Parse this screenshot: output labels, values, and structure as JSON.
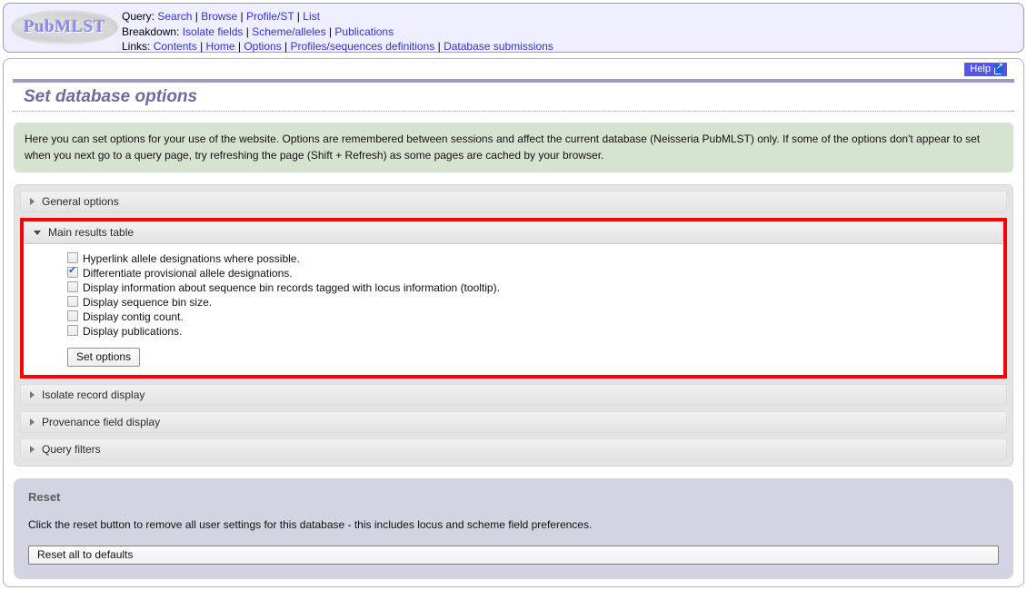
{
  "header": {
    "logo_text": "PubMLST",
    "rows": [
      {
        "label": "Query:",
        "links": [
          "Search",
          "Browse",
          "Profile/ST",
          "List"
        ]
      },
      {
        "label": "Breakdown:",
        "links": [
          "Isolate fields",
          "Scheme/alleles",
          "Publications"
        ]
      },
      {
        "label": "Links:",
        "links": [
          "Contents",
          "Home",
          "Options",
          "Profiles/sequences definitions",
          "Database submissions"
        ]
      }
    ]
  },
  "page": {
    "help_label": "Help",
    "title": "Set database options",
    "info_text": "Here you can set options for your use of the website. Options are remembered between sessions and affect the current database (Neisseria PubMLST) only. If some of the options don't appear to set when you next go to a query page, try refreshing the page (Shift + Refresh) as some pages are cached by your browser."
  },
  "accordion": {
    "general_options": {
      "label": "General options",
      "expanded": false
    },
    "main_results_table": {
      "label": "Main results table",
      "expanded": true,
      "highlighted": true,
      "options": [
        {
          "label": "Hyperlink allele designations where possible.",
          "checked": false
        },
        {
          "label": "Differentiate provisional allele designations.",
          "checked": true
        },
        {
          "label": "Display information about sequence bin records tagged with locus information (tooltip).",
          "checked": false
        },
        {
          "label": "Display sequence bin size.",
          "checked": false
        },
        {
          "label": "Display contig count.",
          "checked": false
        },
        {
          "label": "Display publications.",
          "checked": false
        }
      ],
      "submit_label": "Set options"
    },
    "isolate_record_display": {
      "label": "Isolate record display",
      "expanded": false
    },
    "provenance_field_display": {
      "label": "Provenance field display",
      "expanded": false
    },
    "query_filters": {
      "label": "Query filters",
      "expanded": false
    }
  },
  "reset": {
    "title": "Reset",
    "text": "Click the reset button to remove all user settings for this database - this includes locus and scheme field preferences.",
    "button_label": "Reset all to defaults"
  },
  "colors": {
    "highlight": "#ff0000",
    "link": "#3333cc",
    "help_button": "#5555ee",
    "info_background": "#d7e3d1",
    "reset_background": "#d2d4e2",
    "title": "#6b6b9e"
  }
}
